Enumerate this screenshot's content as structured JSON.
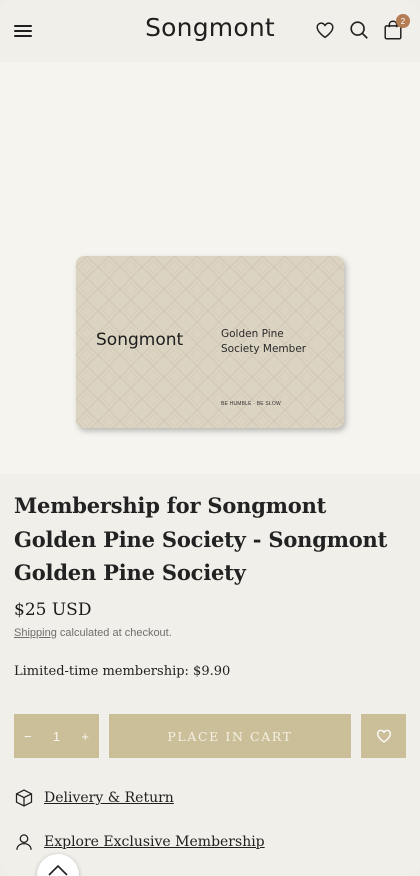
{
  "header": {
    "brand": "Songmont",
    "cart_count": "2",
    "icons": [
      "menu-icon",
      "heart-icon",
      "search-icon",
      "bag-icon"
    ]
  },
  "card": {
    "brand": "Songmont",
    "tier": "Golden Pine Society Member",
    "motto": "BE HUMBLE · BE SLOW"
  },
  "product": {
    "title": "Membership for Songmont Golden Pine Society - Songmont Golden Pine Society",
    "price": "$25 USD",
    "shipping_link": "Shipping",
    "shipping_note": " calculated at checkout.",
    "membership_line": "Limited-time membership: $9.90"
  },
  "cart": {
    "minus": "−",
    "quantity": "1",
    "plus": "+",
    "place_label": "PLACE IN CART"
  },
  "links": {
    "delivery": "Delivery & Return",
    "membership": "Explore Exclusive Membership"
  },
  "colors": {
    "accent": "#cbbf9a",
    "badge": "#b47c52",
    "card": "#dcd4c3"
  }
}
